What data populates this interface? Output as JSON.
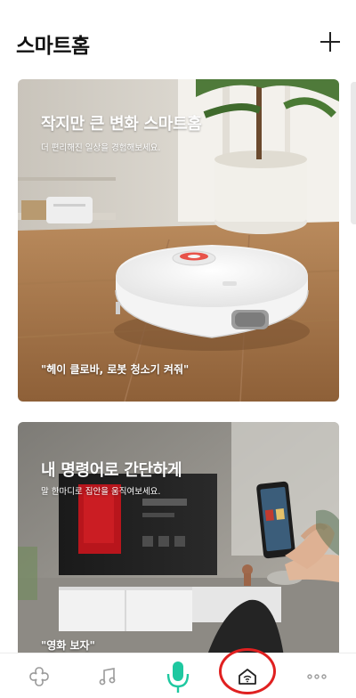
{
  "header": {
    "title": "스마트홈",
    "add_icon": "plus-icon"
  },
  "cards": [
    {
      "title": "작지만 큰 변화 스마트홈",
      "subtitle": "더 편리해진 일상을 경험해보세요.",
      "quote": "\"헤이 클로바, 로봇 청소기 켜줘\""
    },
    {
      "title": "내 명령어로 간단하게",
      "subtitle": "말 한마디로 집안을 움직여보세요.",
      "quote": "\"영화 보자\""
    }
  ],
  "nav": {
    "items": [
      {
        "icon": "clover-icon"
      },
      {
        "icon": "music-note-icon"
      },
      {
        "icon": "microphone-icon",
        "color": "#1ec8a0"
      },
      {
        "icon": "smart-home-icon"
      },
      {
        "icon": "more-icon"
      }
    ],
    "selected": "smart-home-icon",
    "highlight_color": "#e02020"
  }
}
